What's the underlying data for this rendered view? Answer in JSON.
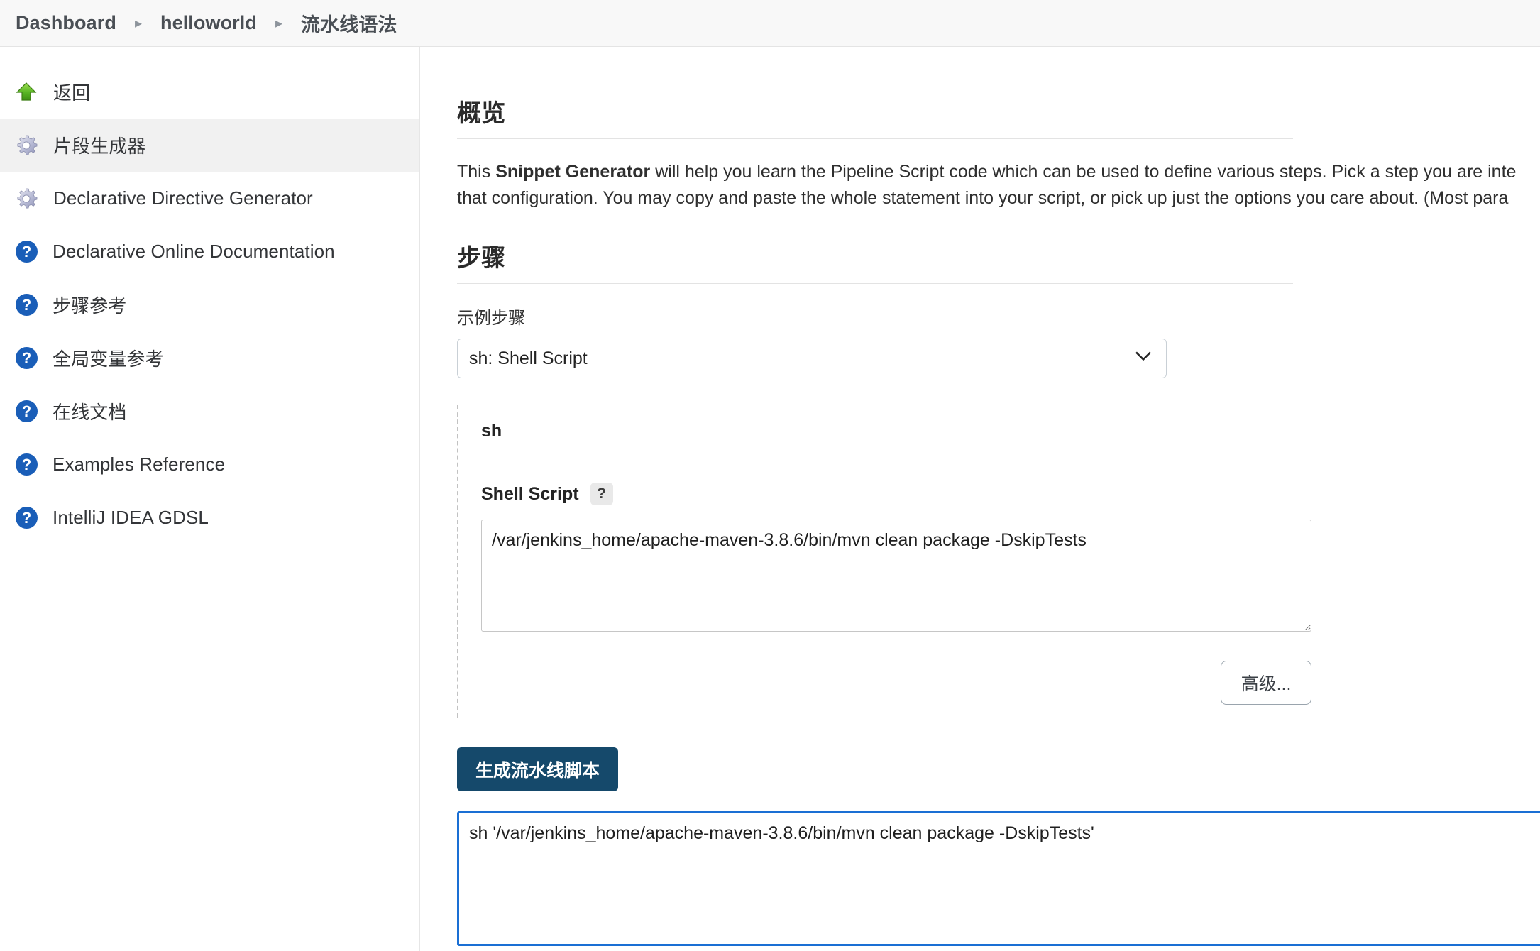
{
  "breadcrumb": {
    "items": [
      {
        "label": "Dashboard"
      },
      {
        "label": "helloworld"
      },
      {
        "label": "流水线语法"
      }
    ],
    "separator": "▸"
  },
  "sidebar": {
    "items": [
      {
        "label": "返回",
        "icon": "up-arrow-icon",
        "active": false
      },
      {
        "label": "片段生成器",
        "icon": "gear-icon",
        "active": true
      },
      {
        "label": "Declarative Directive Generator",
        "icon": "gear-icon",
        "active": false
      },
      {
        "label": "Declarative Online Documentation",
        "icon": "help-icon",
        "active": false
      },
      {
        "label": "步骤参考",
        "icon": "help-icon",
        "active": false
      },
      {
        "label": "全局变量参考",
        "icon": "help-icon",
        "active": false
      },
      {
        "label": "在线文档",
        "icon": "help-icon",
        "active": false
      },
      {
        "label": "Examples Reference",
        "icon": "help-icon",
        "active": false
      },
      {
        "label": "IntelliJ IDEA GDSL",
        "icon": "help-icon",
        "active": false
      }
    ]
  },
  "main": {
    "overview": {
      "title": "概览",
      "paragraph": "This Snippet Generator will help you learn the Pipeline Script code which can be used to define various steps. Pick a step you are interested in from the list, configure it, click Generate Pipeline Script, and you will see a Pipeline Script statement that would call the step with that configuration. You may copy and paste the whole statement into your script, or pick up just the options you care about. (Most para",
      "bold_phrase": "Snippet Generator",
      "paragraph_prefix": "This ",
      "paragraph_rest": " will help you learn the Pipeline Script code which can be used to define various steps. Pick a step you are inte\nthat configuration. You may copy and paste the whole statement into your script, or pick up just the options you care about. (Most para"
    },
    "steps": {
      "title": "步骤",
      "sample_step_label": "示例步骤",
      "selected_step": "sh: Shell Script",
      "options": [
        "sh: Shell Script"
      ],
      "chevron_icon": "chevron-down-icon"
    },
    "step_form": {
      "step_name": "sh",
      "param_label": "Shell Script",
      "help_badge": "?",
      "script_value": "/var/jenkins_home/apache-maven-3.8.6/bin/mvn clean package -DskipTests",
      "advanced_button": "高级..."
    },
    "generate": {
      "button_label": "生成流水线脚本",
      "result_value": "sh '/var/jenkins_home/apache-maven-3.8.6/bin/mvn clean package -DskipTests'"
    }
  },
  "colors": {
    "accent_button": "#15496b",
    "focus_border": "#1a6fd4",
    "help_icon": "#1a5eb8",
    "active_row": "#f1f1f1"
  }
}
